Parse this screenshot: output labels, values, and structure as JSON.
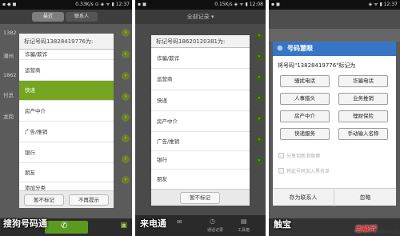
{
  "phone1": {
    "status": {
      "left": "▪ ◆ ◼",
      "right": "0.33K/s ⊙ ◈ ᯤ ▮ 12:37"
    },
    "tabs": [
      "最近",
      "联系人"
    ],
    "bg_rows": [
      "1382",
      "潮州",
      "1862",
      "付总",
      "龙岗"
    ],
    "dialog_title": "标记号码13828419776为:",
    "items": [
      "诈骗/欺诈",
      "运营商",
      "快递",
      "房产中介",
      "广告/推销",
      "银行",
      "朋友",
      "添加分类"
    ],
    "selected_index": 2,
    "buttons": [
      "暂不标记",
      "不再提示"
    ],
    "caption": "搜狗号码通",
    "accent": "#76a522"
  },
  "phone2": {
    "status": {
      "left": "▪ ◼",
      "right": "0.15K/s ◈ ᯤ ▮ 12:08"
    },
    "header": "全部记录 ▾",
    "dialog_title": "标记号码18620120381为:",
    "items": [
      "诈骗/欺诈",
      "运营商",
      "快递",
      "房产中介",
      "广告/推销",
      "银行",
      "朋友"
    ],
    "button": "暂不标记",
    "caption": "来电通",
    "nav": [
      "",
      "",
      "通话记录",
      "工具箱"
    ]
  },
  "phone3": {
    "status": {
      "left": "▪ ◼",
      "right": "◈ ᯤ ▮ 12:37"
    },
    "dialog_head": "号码慧眼",
    "question": "将号码\"13828419776\"标记为",
    "chips": [
      "骚扰电话",
      "诈骗电话",
      "人事猎头",
      "业务推销",
      "房产中介",
      "理财保险",
      "快递服务",
      "手动输入名称"
    ],
    "checks": [
      "分享到新浪微博",
      "将此号码加入黑名单"
    ],
    "footer": [
      "存为联系人",
      "忽略"
    ],
    "caption": "触宝",
    "watermark": "泡椒网",
    "watermark2": "Paojiao.cn"
  }
}
